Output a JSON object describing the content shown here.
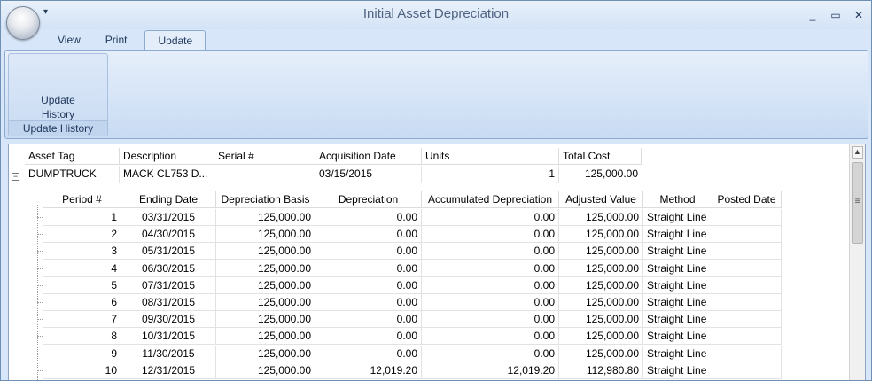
{
  "window": {
    "title": "Initial Asset Depreciation",
    "qat_glyph": "▾",
    "controls": {
      "minimize": "_",
      "maximize": "▭",
      "close": "✕"
    }
  },
  "ribbon": {
    "tabs": [
      {
        "label": "View"
      },
      {
        "label": "Print"
      },
      {
        "label": "Update"
      }
    ],
    "active_tab": "Update",
    "group": {
      "button_line1": "Update",
      "button_line2": "History",
      "label": "Update History"
    }
  },
  "grid": {
    "columns": [
      "Asset Tag",
      "Description",
      "Serial #",
      "Acquisition Date",
      "Units",
      "Total Cost"
    ],
    "asset": {
      "expander": "−",
      "asset_tag": "DUMPTRUCK",
      "description": "MACK CL753 D...",
      "serial": "",
      "acquisition_date": "03/15/2015",
      "units": "1",
      "total_cost": "125,000.00"
    },
    "detail_columns": [
      "Period #",
      "Ending Date",
      "Depreciation Basis",
      "Depreciation",
      "Accumulated Depreciation",
      "Adjusted Value",
      "Method",
      "Posted Date"
    ],
    "rows": [
      {
        "period": "1",
        "ending_date": "03/31/2015",
        "basis": "125,000.00",
        "depreciation": "0.00",
        "accumulated": "0.00",
        "adjusted": "125,000.00",
        "method": "Straight Line",
        "posted": ""
      },
      {
        "period": "2",
        "ending_date": "04/30/2015",
        "basis": "125,000.00",
        "depreciation": "0.00",
        "accumulated": "0.00",
        "adjusted": "125,000.00",
        "method": "Straight Line",
        "posted": ""
      },
      {
        "period": "3",
        "ending_date": "05/31/2015",
        "basis": "125,000.00",
        "depreciation": "0.00",
        "accumulated": "0.00",
        "adjusted": "125,000.00",
        "method": "Straight Line",
        "posted": ""
      },
      {
        "period": "4",
        "ending_date": "06/30/2015",
        "basis": "125,000.00",
        "depreciation": "0.00",
        "accumulated": "0.00",
        "adjusted": "125,000.00",
        "method": "Straight Line",
        "posted": ""
      },
      {
        "period": "5",
        "ending_date": "07/31/2015",
        "basis": "125,000.00",
        "depreciation": "0.00",
        "accumulated": "0.00",
        "adjusted": "125,000.00",
        "method": "Straight Line",
        "posted": ""
      },
      {
        "period": "6",
        "ending_date": "08/31/2015",
        "basis": "125,000.00",
        "depreciation": "0.00",
        "accumulated": "0.00",
        "adjusted": "125,000.00",
        "method": "Straight Line",
        "posted": ""
      },
      {
        "period": "7",
        "ending_date": "09/30/2015",
        "basis": "125,000.00",
        "depreciation": "0.00",
        "accumulated": "0.00",
        "adjusted": "125,000.00",
        "method": "Straight Line",
        "posted": ""
      },
      {
        "period": "8",
        "ending_date": "10/31/2015",
        "basis": "125,000.00",
        "depreciation": "0.00",
        "accumulated": "0.00",
        "adjusted": "125,000.00",
        "method": "Straight Line",
        "posted": ""
      },
      {
        "period": "9",
        "ending_date": "11/30/2015",
        "basis": "125,000.00",
        "depreciation": "0.00",
        "accumulated": "0.00",
        "adjusted": "125,000.00",
        "method": "Straight Line",
        "posted": ""
      },
      {
        "period": "10",
        "ending_date": "12/31/2015",
        "basis": "125,000.00",
        "depreciation": "12,019.20",
        "accumulated": "12,019.20",
        "adjusted": "112,980.80",
        "method": "Straight Line",
        "posted": ""
      }
    ]
  },
  "scrollbar": {
    "up_arrow": "▲",
    "grip": "≡"
  }
}
